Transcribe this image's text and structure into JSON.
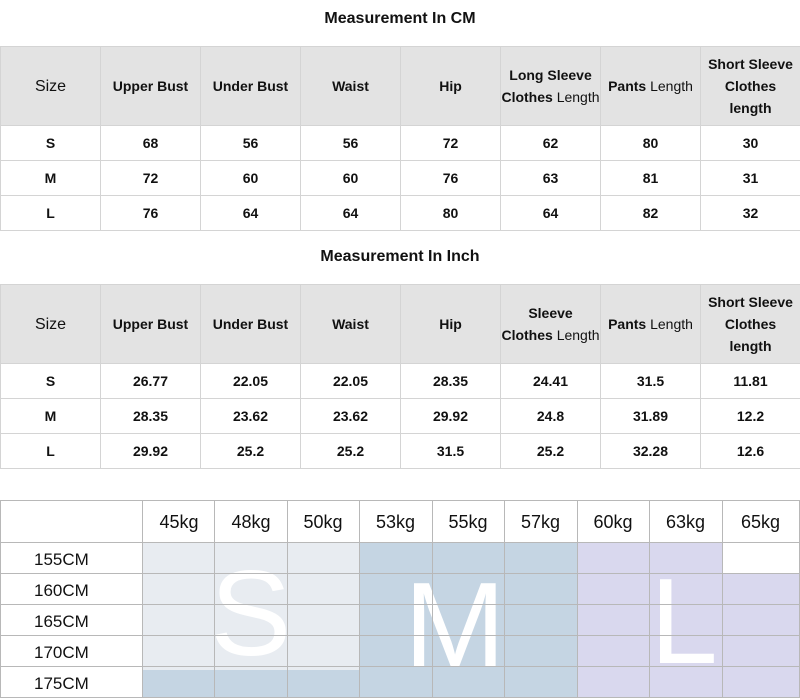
{
  "cm_section": {
    "title": "Measurement In CM",
    "header": {
      "size": "Size",
      "upper_bust": "Upper Bust",
      "under_bust": "Under Bust",
      "waist": "Waist",
      "hip": "Hip",
      "long_sleeve_line1": "Long Sleeve",
      "long_sleeve_line2a": "Clothes",
      "long_sleeve_line2b": "Length",
      "pants_a": "Pants",
      "pants_b": "Length",
      "short_sleeve_line1": "Short Sleeve",
      "short_sleeve_line2": "Clothes",
      "short_sleeve_line3": "length"
    },
    "rows": [
      [
        "S",
        "68",
        "56",
        "56",
        "72",
        "62",
        "80",
        "30"
      ],
      [
        "M",
        "72",
        "60",
        "60",
        "76",
        "63",
        "81",
        "31"
      ],
      [
        "L",
        "76",
        "64",
        "64",
        "80",
        "64",
        "82",
        "32"
      ]
    ]
  },
  "inch_section": {
    "title": "Measurement In Inch",
    "header": {
      "size": "Size",
      "upper_bust": "Upper Bust",
      "under_bust": "Under Bust",
      "waist": "Waist",
      "hip": "Hip",
      "sleeve_line1": "Sleeve",
      "sleeve_line2a": "Clothes",
      "sleeve_line2b": "Length",
      "pants_a": "Pants",
      "pants_b": "Length",
      "short_sleeve_line1": "Short Sleeve",
      "short_sleeve_line2": "Clothes",
      "short_sleeve_line3": "length"
    },
    "rows": [
      [
        "S",
        "26.77",
        "22.05",
        "22.05",
        "28.35",
        "24.41",
        "31.5",
        "11.81"
      ],
      [
        "M",
        "28.35",
        "23.62",
        "23.62",
        "29.92",
        "24.8",
        "31.89",
        "12.2"
      ],
      [
        "L",
        "29.92",
        "25.2",
        "25.2",
        "31.5",
        "25.2",
        "32.28",
        "12.6"
      ]
    ]
  },
  "size_chart": {
    "weights": [
      "45kg",
      "48kg",
      "50kg",
      "53kg",
      "55kg",
      "57kg",
      "60kg",
      "63kg",
      "65kg"
    ],
    "heights": [
      "155CM",
      "160CM",
      "165CM",
      "170CM",
      "175CM"
    ],
    "size_letters": [
      "S",
      "M",
      "L"
    ],
    "colors": {
      "s_zone": "#e8ecf1",
      "m_zone": "#c5d5e3",
      "l_zone": "#d9d8ee"
    }
  }
}
